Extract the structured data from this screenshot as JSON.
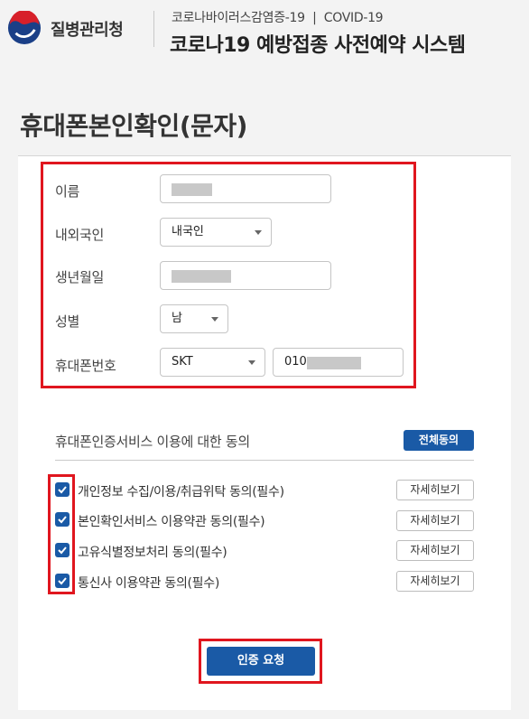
{
  "header": {
    "org_name": "질병관리청",
    "subtitle": "코로나바이러스감염증-19  |  COVID-19",
    "title": "코로나19 예방접종 사전예약 시스템"
  },
  "page_title": "휴대폰본인확인(문자)",
  "form": {
    "name_label": "이름",
    "nationality_label": "내외국인",
    "nationality_value": "내국인",
    "birth_label": "생년월일",
    "gender_label": "성별",
    "gender_value": "남",
    "phone_label": "휴대폰번호",
    "carrier_value": "SKT",
    "phone_prefix": "010"
  },
  "consent": {
    "heading": "휴대폰인증서비스 이용에 대한 동의",
    "all_agree_label": "전체동의",
    "detail_label": "자세히보기",
    "items": [
      {
        "label": "개인정보 수집/이용/취급위탁 동의(필수)",
        "checked": true
      },
      {
        "label": "본인확인서비스 이용약관 동의(필수)",
        "checked": true
      },
      {
        "label": "고유식별정보처리 동의(필수)",
        "checked": true
      },
      {
        "label": "통신사 이용약관 동의(필수)",
        "checked": true
      }
    ]
  },
  "submit_label": "인증 요청",
  "colors": {
    "accent": "#1a5aa6",
    "highlight": "#e0161f"
  }
}
